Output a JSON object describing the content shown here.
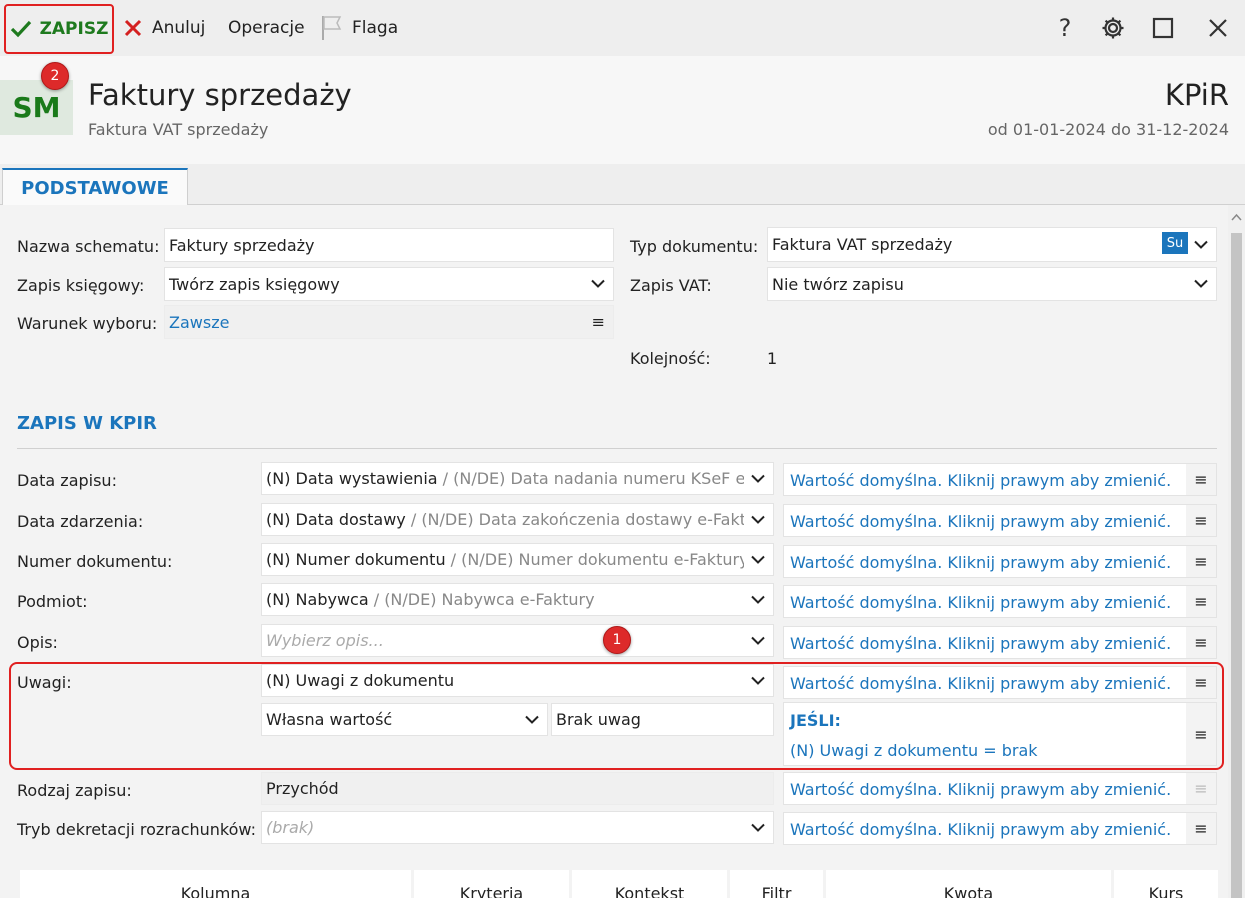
{
  "toolbar": {
    "save_label": "ZAPISZ",
    "cancel_label": "Anuluj",
    "operations_label": "Operacje",
    "flag_label": "Flaga",
    "help_glyph": "?"
  },
  "badges": {
    "save": "2",
    "opis": "1"
  },
  "header": {
    "logo": "SM",
    "title": "Faktury sprzedaży",
    "subtitle": "Faktura VAT sprzedaży",
    "brand": "KPiR",
    "period": "od 01-01-2024 do 31-12-2024"
  },
  "tabs": [
    {
      "label": "PODSTAWOWE"
    }
  ],
  "basic": {
    "nazwa_label": "Nazwa schematu:",
    "nazwa_value": "Faktury sprzedaży",
    "zapis_ksiegowy_label": "Zapis księgowy:",
    "zapis_ksiegowy_value": "Twórz zapis księgowy",
    "warunek_label": "Warunek wyboru:",
    "warunek_value": "Zawsze",
    "typ_label": "Typ dokumentu:",
    "typ_value": "Faktura VAT sprzedaży",
    "typ_badge": "Su",
    "zapis_vat_label": "Zapis VAT:",
    "zapis_vat_value": "Nie twórz zapisu",
    "kolejnosc_label": "Kolejność:",
    "kolejnosc_value": "1"
  },
  "section": {
    "title": "ZAPIS W KPIR"
  },
  "default_text": "Wartość domyślna. Kliknij prawym aby zmienić.",
  "menu_glyph": "≡",
  "rows": [
    {
      "label": "Data zapisu:",
      "main": "(N) Data wystawienia",
      "alt": " / (N/DE) Data nadania numeru KSeF e-Faktury"
    },
    {
      "label": "Data zdarzenia:",
      "main": "(N) Data dostawy",
      "alt": " / (N/DE) Data zakończenia dostawy e-Faktury"
    },
    {
      "label": "Numer dokumentu:",
      "main": "(N) Numer dokumentu",
      "alt": " / (N/DE) Numer dokumentu e-Faktury"
    },
    {
      "label": "Podmiot:",
      "main": "(N) Nabywca",
      "alt": " / (N/DE) Nabywca e-Faktury"
    },
    {
      "label": "Opis:",
      "placeholder": "Wybierz opis..."
    },
    {
      "label": "Uwagi:",
      "main": "(N) Uwagi z dokumentu"
    }
  ],
  "uwagi_extra": {
    "own_value_select": "Własna wartość",
    "own_value_text": "Brak uwag",
    "cond_title": "JEŚLI:",
    "cond_text": "(N) Uwagi z dokumentu = brak"
  },
  "rodzaj": {
    "label": "Rodzaj zapisu:",
    "value": "Przychód"
  },
  "tryb": {
    "label": "Tryb dekretacji rozrachunków:",
    "placeholder": "(brak)"
  },
  "grid_headers": [
    "Kolumna",
    "Kryteria",
    "Kontekst",
    "Filtr",
    "Kwota",
    "Kurs"
  ]
}
